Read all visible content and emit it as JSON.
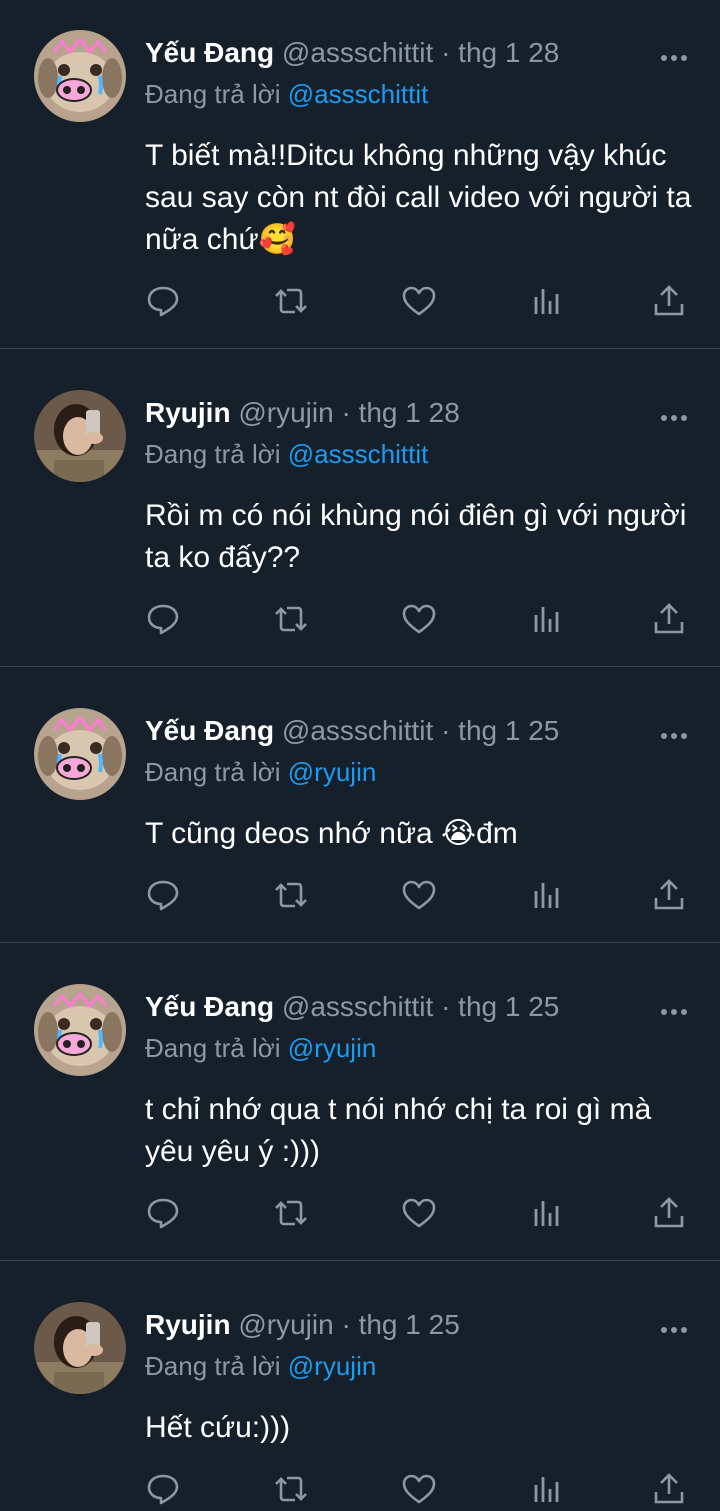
{
  "tweets": [
    {
      "name": "Yếu Đang",
      "handle": "@assschittit",
      "dot": "·",
      "time": "thg 1 28",
      "reply_prefix": "Đang trả lời ",
      "reply_to": "@assschittit",
      "text": "T biết mà!!Ditcu không những vậy khúc sau say còn nt đòi call video với người ta nữa chứ🥰",
      "avatar": "puppy"
    },
    {
      "name": "Ryujin",
      "handle": "@ryujin",
      "dot": "·",
      "time": "thg 1 28",
      "reply_prefix": "Đang trả lời ",
      "reply_to": "@assschittit",
      "text": "Rồi m có nói khùng nói điên gì với người ta ko đấy??",
      "avatar": "girl"
    },
    {
      "name": "Yếu Đang",
      "handle": "@assschittit",
      "dot": "·",
      "time": "thg 1 25",
      "reply_prefix": "Đang trả lời ",
      "reply_to": "@ryujin",
      "text": "T cũng deos nhớ nữa 😭đm",
      "avatar": "puppy"
    },
    {
      "name": "Yếu Đang",
      "handle": "@assschittit",
      "dot": "·",
      "time": "thg 1 25",
      "reply_prefix": "Đang trả lời ",
      "reply_to": "@ryujin",
      "text": "t chỉ nhớ qua t nói nhớ chị ta roi gì mà yêu yêu ý :)))",
      "avatar": "puppy"
    },
    {
      "name": "Ryujin",
      "handle": "@ryujin",
      "dot": "·",
      "time": "thg 1 25",
      "reply_prefix": "Đang trả lời ",
      "reply_to": "@ryujin",
      "text": "Hết cứu:)))",
      "avatar": "girl"
    }
  ],
  "icons": {
    "reply": "reply-icon",
    "retweet": "retweet-icon",
    "like": "heart-icon",
    "views": "analytics-icon",
    "share": "share-icon",
    "more": "more-icon"
  },
  "colors": {
    "background": "#15202b",
    "text": "#ffffff",
    "muted": "#8b98a5",
    "mention": "#1d9bf0",
    "divider": "#38444d"
  }
}
